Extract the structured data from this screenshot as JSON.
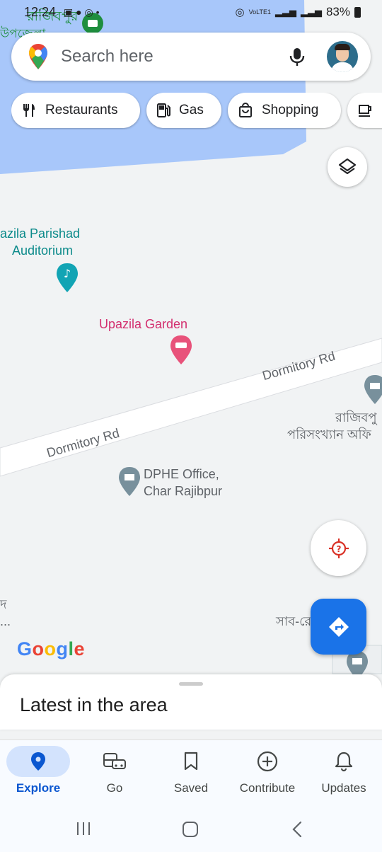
{
  "status_bar": {
    "time": "12:24",
    "battery": "83%",
    "lte_label": "VoLTE1"
  },
  "search": {
    "placeholder": "Search here"
  },
  "chips": [
    {
      "label": "Restaurants",
      "icon": "fork-knife-icon"
    },
    {
      "label": "Gas",
      "icon": "gas-pump-icon"
    },
    {
      "label": "Shopping",
      "icon": "shopping-bag-icon"
    },
    {
      "label": "",
      "icon": "coffee-icon"
    }
  ],
  "map": {
    "labels": {
      "top_bengali": "রাজিবপুর",
      "top_bengali_2": "উপজেলা",
      "auditorium_line1": "azila Parishad",
      "auditorium_line2": "Auditorium",
      "garden": "Upazila Garden",
      "road_upper": "Dormitory Rd",
      "road_lower": "Dormitory Rd",
      "right_bengali_1": "রাজিবপু",
      "right_bengali_2": "পরিসংখ্যান অফি",
      "dphe_line1": "DPHE Office,",
      "dphe_line2": "Char Rajibpur",
      "left_bengali_1": "দ",
      "left_bengali_2": "...",
      "bottom_right_bengali": "সাব-রে          র"
    },
    "water_color": "#a8c7fa",
    "road_color": "#ffffff"
  },
  "brand": {
    "logo_text": "Google"
  },
  "sheet": {
    "title": "Latest in the area"
  },
  "nav": [
    {
      "label": "Explore",
      "icon": "location-pin-icon",
      "active": true
    },
    {
      "label": "Go",
      "icon": "commute-icon",
      "active": false
    },
    {
      "label": "Saved",
      "icon": "bookmark-icon",
      "active": false
    },
    {
      "label": "Contribute",
      "icon": "add-circle-icon",
      "active": false
    },
    {
      "label": "Updates",
      "icon": "bell-icon",
      "active": false
    }
  ],
  "colors": {
    "accent": "#1a73e8",
    "teal": "#0b8a8a",
    "pink": "#d32f6f"
  }
}
